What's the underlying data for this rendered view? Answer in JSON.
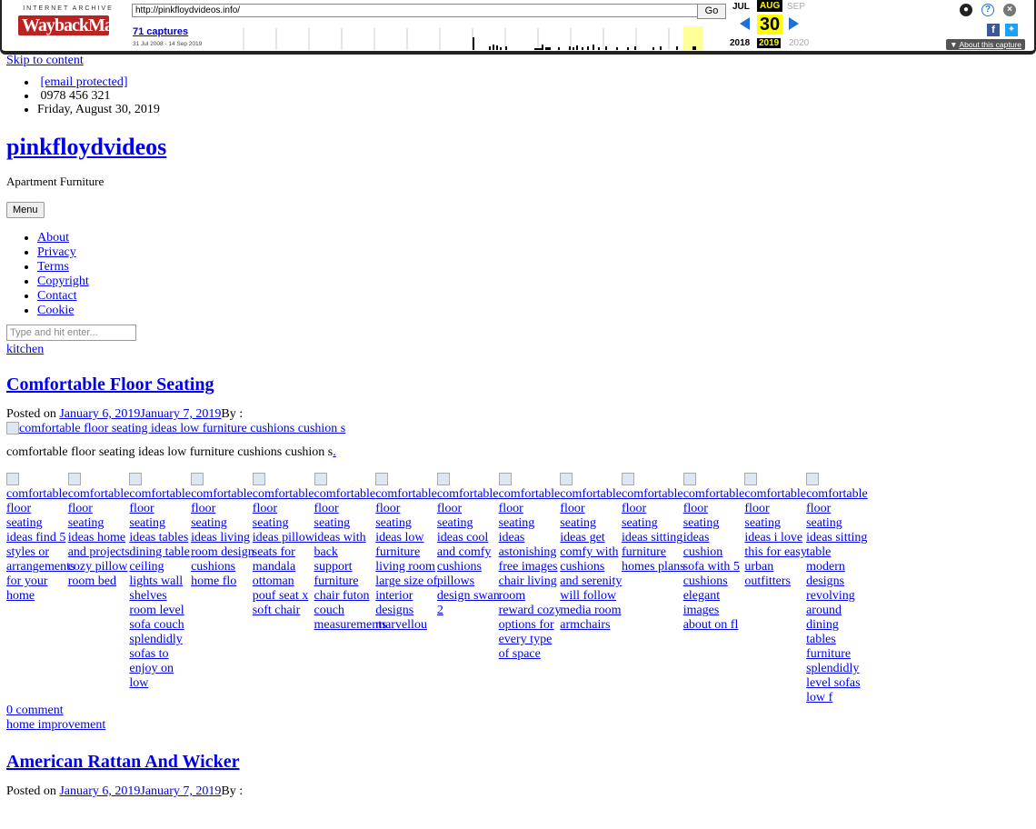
{
  "toolbar": {
    "logo_top": "INTERNET ARCHIVE",
    "logo_main": "WaybackMachine",
    "url": "http://pinkfloydvideos.info/",
    "go_label": "Go",
    "captures": "71 captures",
    "date_range": "31 Jul 2008 - 14 Sep 2019",
    "months": {
      "prev": "JUL",
      "cur": "AUG",
      "next": "SEP"
    },
    "day": "30",
    "years": {
      "prev": "2018",
      "cur": "2019",
      "next": "2020"
    },
    "about": "About this capture",
    "icons": {
      "user": "user-icon",
      "help": "help-icon",
      "close": "close-icon",
      "facebook": "facebook-icon",
      "twitter": "twitter-icon"
    }
  },
  "page": {
    "skip": "Skip to content",
    "top_info": [
      "[email protected]",
      "0978 456 321",
      "Friday, August 30, 2019"
    ],
    "site_title": "pinkfloydvideos",
    "tagline": "Apartment Furniture",
    "menu_label": "Menu",
    "nav": [
      "About",
      "Privacy",
      "Terms",
      "Copyright",
      "Contact",
      "Cookie"
    ],
    "search_placeholder": "Type and hit enter...",
    "category": "kitchen",
    "post": {
      "title": "Comfortable Floor Seating",
      "posted_on": "Posted on",
      "dates": "January 6, 2019January 7, 2019",
      "by": "By :",
      "image_alt": "comfortable floor seating ideas low furniture cushions cushion s",
      "excerpt": "comfortable floor seating ideas low furniture cushions cushion s",
      "excerpt_link": ".",
      "gallery": [
        "comfortable floor seating ideas find 5 styles or arrangements for your home",
        "comfortable floor seating ideas home and projects cozy pillow room bed",
        "comfortable floor seating ideas tables dining table ceiling lights wall shelves room level sofa couch splendidly sofas to enjoy on low",
        "comfortable floor seating ideas living room design cushions home flo",
        "comfortable floor seating ideas pillow seats for mandala ottoman pouf seat x soft chair",
        "comfortable floor seating ideas with back support furniture chair futon couch measurements",
        "comfortable floor seating ideas low furniture living room large size of interior designs marvellou",
        "comfortable floor seating ideas cool and comfy cushions pillows design swan 2",
        "comfortable floor seating ideas astonishing free images chair living room reward cozy options for every type of space",
        "comfortable floor seating ideas get comfy with cushions and serenity will follow media room armchairs",
        "comfortable floor seating ideas sitting furniture homes plans",
        "comfortable floor seating ideas cushion sofa with 5 cushions elegant images about on fl",
        "comfortable floor seating ideas i love this for easy urban outfitters",
        "comfortable floor seating ideas sitting table modern designs revolving around dining tables furniture splendidly level sofas low f"
      ],
      "comments": "0 comment",
      "footer_category": "home improvement"
    },
    "next_post": {
      "title": "American Rattan And Wicker",
      "posted_on": "Posted on",
      "dates": "January 6, 2019January 7, 2019",
      "by": "By :"
    }
  }
}
